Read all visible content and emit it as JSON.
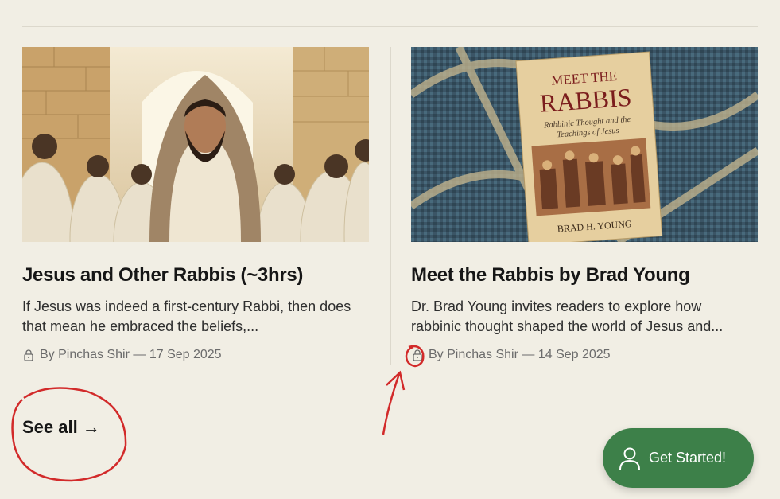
{
  "articles": [
    {
      "title": "Jesus and Other Rabbis (~3hrs)",
      "excerpt": "If Jesus was indeed a first-century Rabbi, then does that mean he embraced the beliefs,...",
      "meta": "By Pinchas Shir — 17 Sep 2025",
      "icon": "lock-icon"
    },
    {
      "title": "Meet the Rabbis by Brad Young",
      "excerpt": "Dr. Brad Young invites readers to explore how rabbinic thought shaped the world of Jesus and...",
      "meta": "By Pinchas Shir — 14 Sep 2025",
      "icon": "lock-icon",
      "book_cover": {
        "line1": "MEET THE",
        "line2": "RABBIS",
        "subtitle_1": "Rabbinic Thought and the",
        "subtitle_2": "Teachings of Jesus",
        "author": "BRAD H. YOUNG"
      }
    }
  ],
  "see_all": {
    "label": "See all",
    "arrow": "→"
  },
  "cta": {
    "label": "Get Started!",
    "icon": "user-icon",
    "color": "#3d8049"
  },
  "colors": {
    "background": "#f1eee4",
    "annotation": "#d22a2a"
  }
}
